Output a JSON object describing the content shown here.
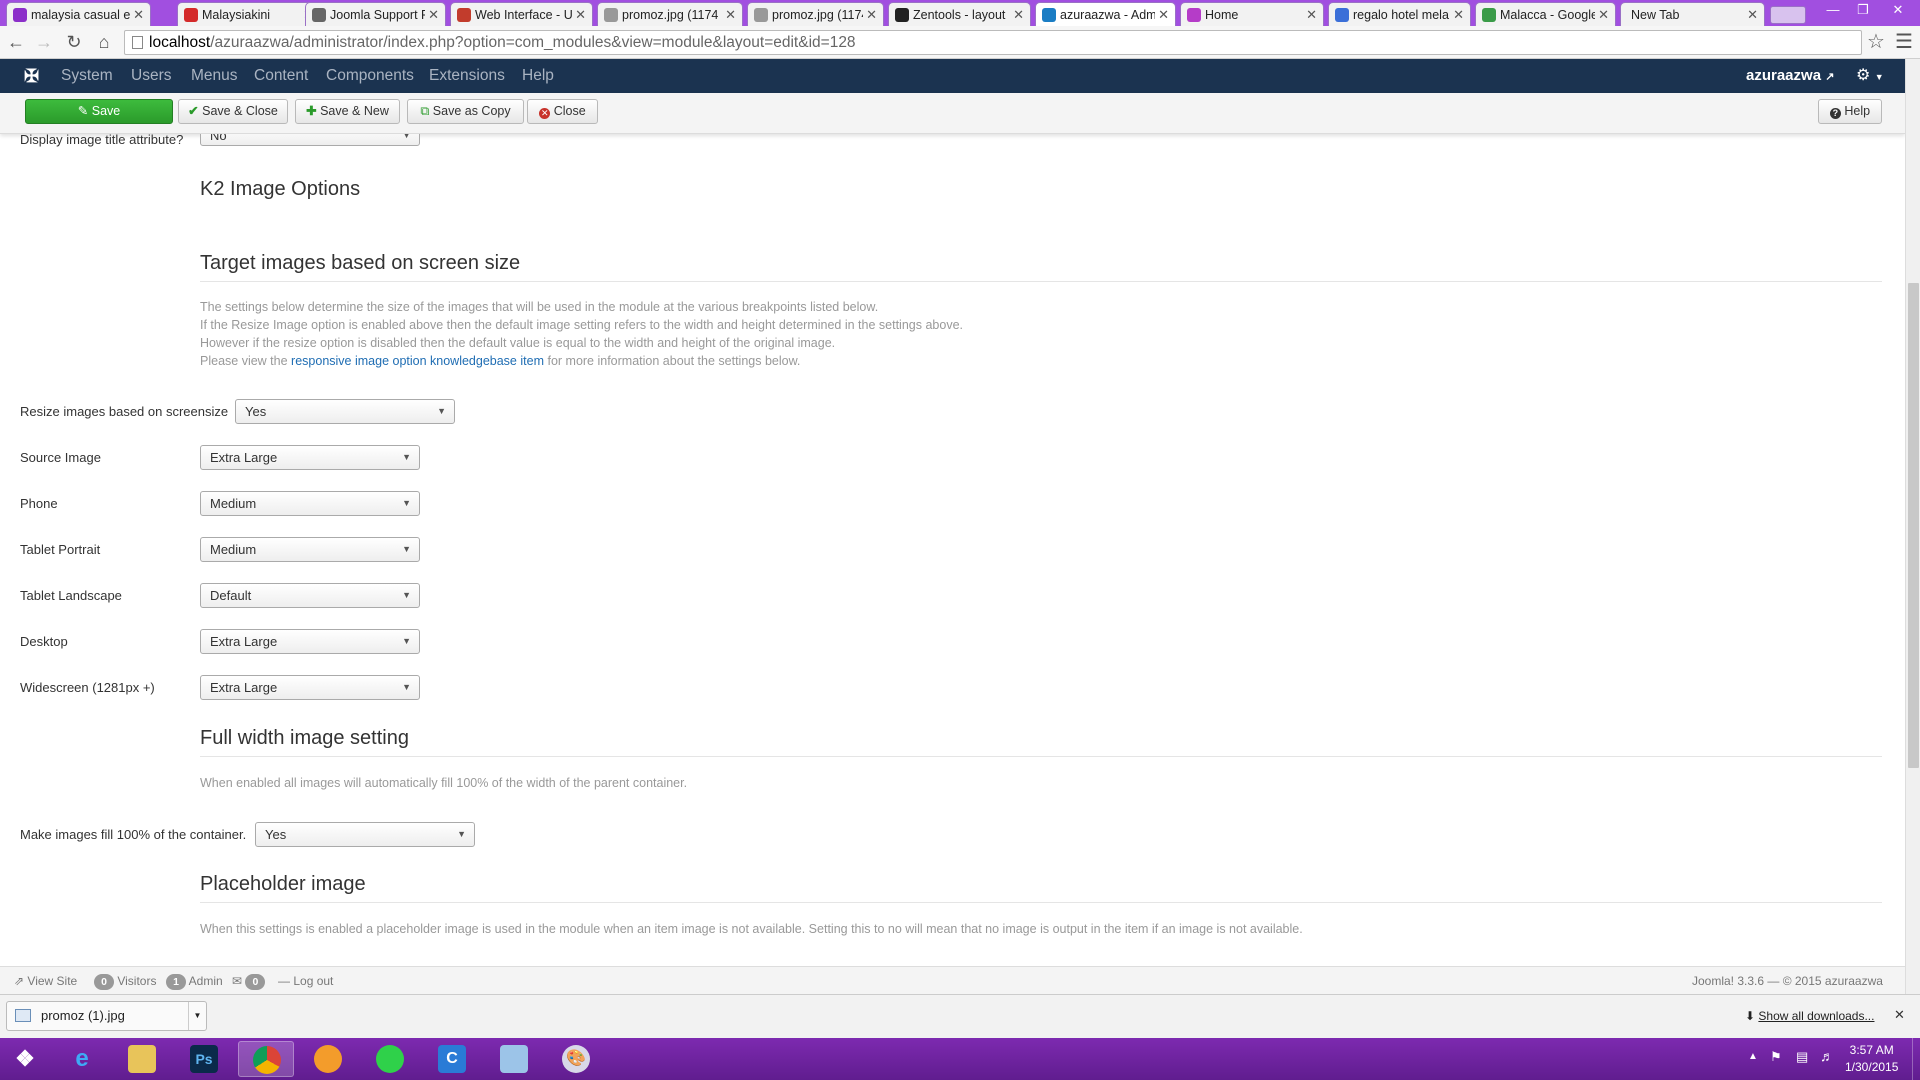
{
  "browser": {
    "tabs": [
      {
        "title": "malaysia casual e",
        "favicon": "peace-icon",
        "color": "#8b2fc9"
      },
      {
        "title": "Malaysiakini",
        "favicon": "mk-icon",
        "color": "#d42a2a"
      },
      {
        "title": "Joomla Support F",
        "favicon": "document-icon",
        "color": "#666666"
      },
      {
        "title": "Web Interface - U",
        "favicon": "bug-icon",
        "color": "#c23c2c"
      },
      {
        "title": "promoz.jpg (1174",
        "favicon": "file-icon",
        "color": "#999999"
      },
      {
        "title": "promoz.jpg (1174",
        "favicon": "file-icon",
        "color": "#999999"
      },
      {
        "title": "Zentools - layout",
        "favicon": "z-icon",
        "color": "#222222"
      },
      {
        "title": "azuraazwa - Adm",
        "favicon": "joomla-icon",
        "color": "#1a7dc4"
      },
      {
        "title": "Home",
        "favicon": "instagram-icon",
        "color": "#b53cc8"
      },
      {
        "title": "regalo hotel mela",
        "favicon": "google-icon",
        "color": "#3b6fd8"
      },
      {
        "title": "Malacca - Google",
        "favicon": "maps-icon",
        "color": "#3a9b48"
      },
      {
        "title": "New Tab",
        "favicon": "",
        "color": ""
      }
    ],
    "active_tab": 7,
    "url_host": "localhost",
    "url_path": "/azuraazwa/administrator/index.php?option=com_modules&view=module&layout=edit&id=128"
  },
  "jnav": {
    "items": [
      "System",
      "Users",
      "Menus",
      "Content",
      "Components",
      "Extensions",
      "Help"
    ],
    "user": "azuraazwa"
  },
  "toolbar": {
    "save": "Save",
    "save_close": "Save & Close",
    "save_new": "Save & New",
    "save_copy": "Save as Copy",
    "close": "Close",
    "help": "Help"
  },
  "form": {
    "top_field": {
      "label": "Display image title attribute?",
      "value": "No"
    },
    "k2_heading": "K2 Image Options",
    "target_heading": "Target images based on screen size",
    "target_desc": [
      "The settings below determine the size of the images that will be used in the module at the various breakpoints listed below.",
      "If the Resize Image option is enabled above then the default image setting refers to the width and height determined in the settings above.",
      "However if the resize option is disabled then the default value is equal to the width and height of the original image."
    ],
    "target_desc_pre": "Please view the",
    "target_desc_link": "responsive image option knowledgebase item",
    "target_desc_post": "for more information about the settings below.",
    "fields": [
      {
        "label": "Resize images based on screensize",
        "value": "Yes"
      },
      {
        "label": "Source Image",
        "value": "Extra Large"
      },
      {
        "label": "Phone",
        "value": "Medium"
      },
      {
        "label": "Tablet Portrait",
        "value": "Medium"
      },
      {
        "label": "Tablet Landscape",
        "value": "Default"
      },
      {
        "label": "Desktop",
        "value": "Extra Large"
      },
      {
        "label": "Widescreen (1281px +)",
        "value": "Extra Large"
      }
    ],
    "fullwidth_heading": "Full width image setting",
    "fullwidth_desc": "When enabled all images will automatically fill 100% of the width of the parent container.",
    "fullwidth_field": {
      "label": "Make images fill 100% of the container.",
      "value": "Yes"
    },
    "placeholder_heading": "Placeholder image",
    "placeholder_desc": "When this settings is enabled a placeholder image is used in the module when an item image is not available. Setting this to no will mean that no image is output in the item if an image is not available."
  },
  "status": {
    "view_site": "View Site",
    "visitors_count": "0",
    "visitors": "Visitors",
    "admin_count": "1",
    "admin": "Admin",
    "messages_count": "0",
    "logout": "Log out",
    "copyright": "Joomla! 3.3.6 — © 2015 azuraazwa"
  },
  "downloads": {
    "file": "promoz (1).jpg",
    "show_all": "Show all downloads..."
  },
  "taskbar": {
    "apps": [
      "start-icon",
      "ie-icon",
      "folder-icon",
      "photoshop-icon",
      "chrome-icon",
      "app-icon",
      "app-icon",
      "app-icon",
      "window-icon",
      "paint-icon"
    ],
    "time": "3:57 AM",
    "date": "1/30/2015"
  }
}
